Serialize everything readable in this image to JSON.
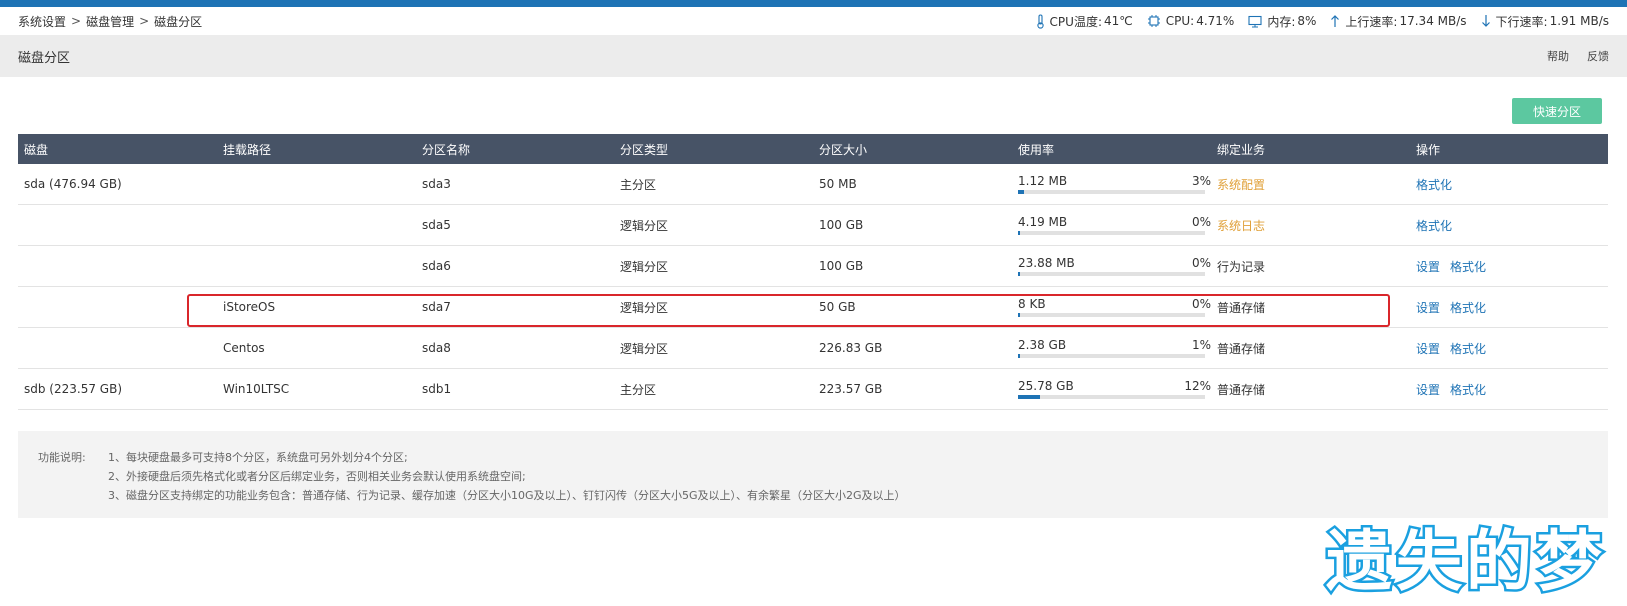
{
  "breadcrumb": [
    "系统设置",
    "磁盘管理",
    "磁盘分区"
  ],
  "breadcrumb_sep": ">",
  "stats": {
    "cpu_temp_label": "CPU温度:",
    "cpu_temp_value": "41℃",
    "cpu_label": "CPU:",
    "cpu_value": "4.71%",
    "mem_label": "内存:",
    "mem_value": "8%",
    "up_label": "上行速率:",
    "up_value": "17.34 MB/s",
    "down_label": "下行速率:",
    "down_value": "1.91 MB/s"
  },
  "header": {
    "title": "磁盘分区",
    "help": "帮助",
    "feedback": "反馈"
  },
  "quick_partition_label": "快速分区",
  "table": {
    "columns": [
      "磁盘",
      "挂载路径",
      "分区名称",
      "分区类型",
      "分区大小",
      "使用率",
      "绑定业务",
      "操作"
    ],
    "rows": [
      {
        "disk": "sda (476.94 GB)",
        "mount": "",
        "name": "sda3",
        "type": "主分区",
        "size": "50 MB",
        "used": "1.12 MB",
        "pct": "3%",
        "usage": 0.03,
        "service": "系统配置",
        "service_style": "orange",
        "actions": [
          "格式化"
        ]
      },
      {
        "disk": "",
        "mount": "",
        "name": "sda5",
        "type": "逻辑分区",
        "size": "100 GB",
        "used": "4.19 MB",
        "pct": "0%",
        "usage": 0.0,
        "service": "系统日志",
        "service_style": "orange",
        "actions": [
          "格式化"
        ]
      },
      {
        "disk": "",
        "mount": "",
        "name": "sda6",
        "type": "逻辑分区",
        "size": "100 GB",
        "used": "23.88 MB",
        "pct": "0%",
        "usage": 0.0,
        "service": "行为记录",
        "service_style": "normal",
        "actions": [
          "设置",
          "格式化"
        ]
      },
      {
        "disk": "",
        "mount": "iStoreOS",
        "name": "sda7",
        "type": "逻辑分区",
        "size": "50 GB",
        "used": "8 KB",
        "pct": "0%",
        "usage": 0.0,
        "service": "普通存储",
        "service_style": "normal",
        "actions": [
          "设置",
          "格式化"
        ]
      },
      {
        "disk": "",
        "mount": "Centos",
        "name": "sda8",
        "type": "逻辑分区",
        "size": "226.83 GB",
        "used": "2.38 GB",
        "pct": "1%",
        "usage": 0.01,
        "service": "普通存储",
        "service_style": "normal",
        "actions": [
          "设置",
          "格式化"
        ]
      },
      {
        "disk": "sdb (223.57 GB)",
        "mount": "Win10LTSC",
        "name": "sdb1",
        "type": "主分区",
        "size": "223.57 GB",
        "used": "25.78 GB",
        "pct": "12%",
        "usage": 0.12,
        "service": "普通存储",
        "service_style": "normal",
        "actions": [
          "设置",
          "格式化"
        ]
      }
    ]
  },
  "notes": {
    "label": "功能说明:",
    "lines": [
      "1、每块硬盘最多可支持8个分区，系统盘可另外划分4个分区;",
      "2、外接硬盘后须先格式化或者分区后绑定业务，否则相关业务会默认使用系统盘空间;",
      "3、磁盘分区支持绑定的功能业务包含：普通存储、行为记录、缓存加速（分区大小10G及以上）、钉钉闪传（分区大小5G及以上）、有余繁星（分区大小2G及以上）"
    ]
  },
  "watermark": "遗失的梦",
  "colors": {
    "accent": "#1e73b5",
    "header_row": "#475366",
    "button": "#5cc8a0",
    "orange": "#e0a038",
    "highlight": "#d9262b",
    "watermark": "#1aa0e0"
  }
}
